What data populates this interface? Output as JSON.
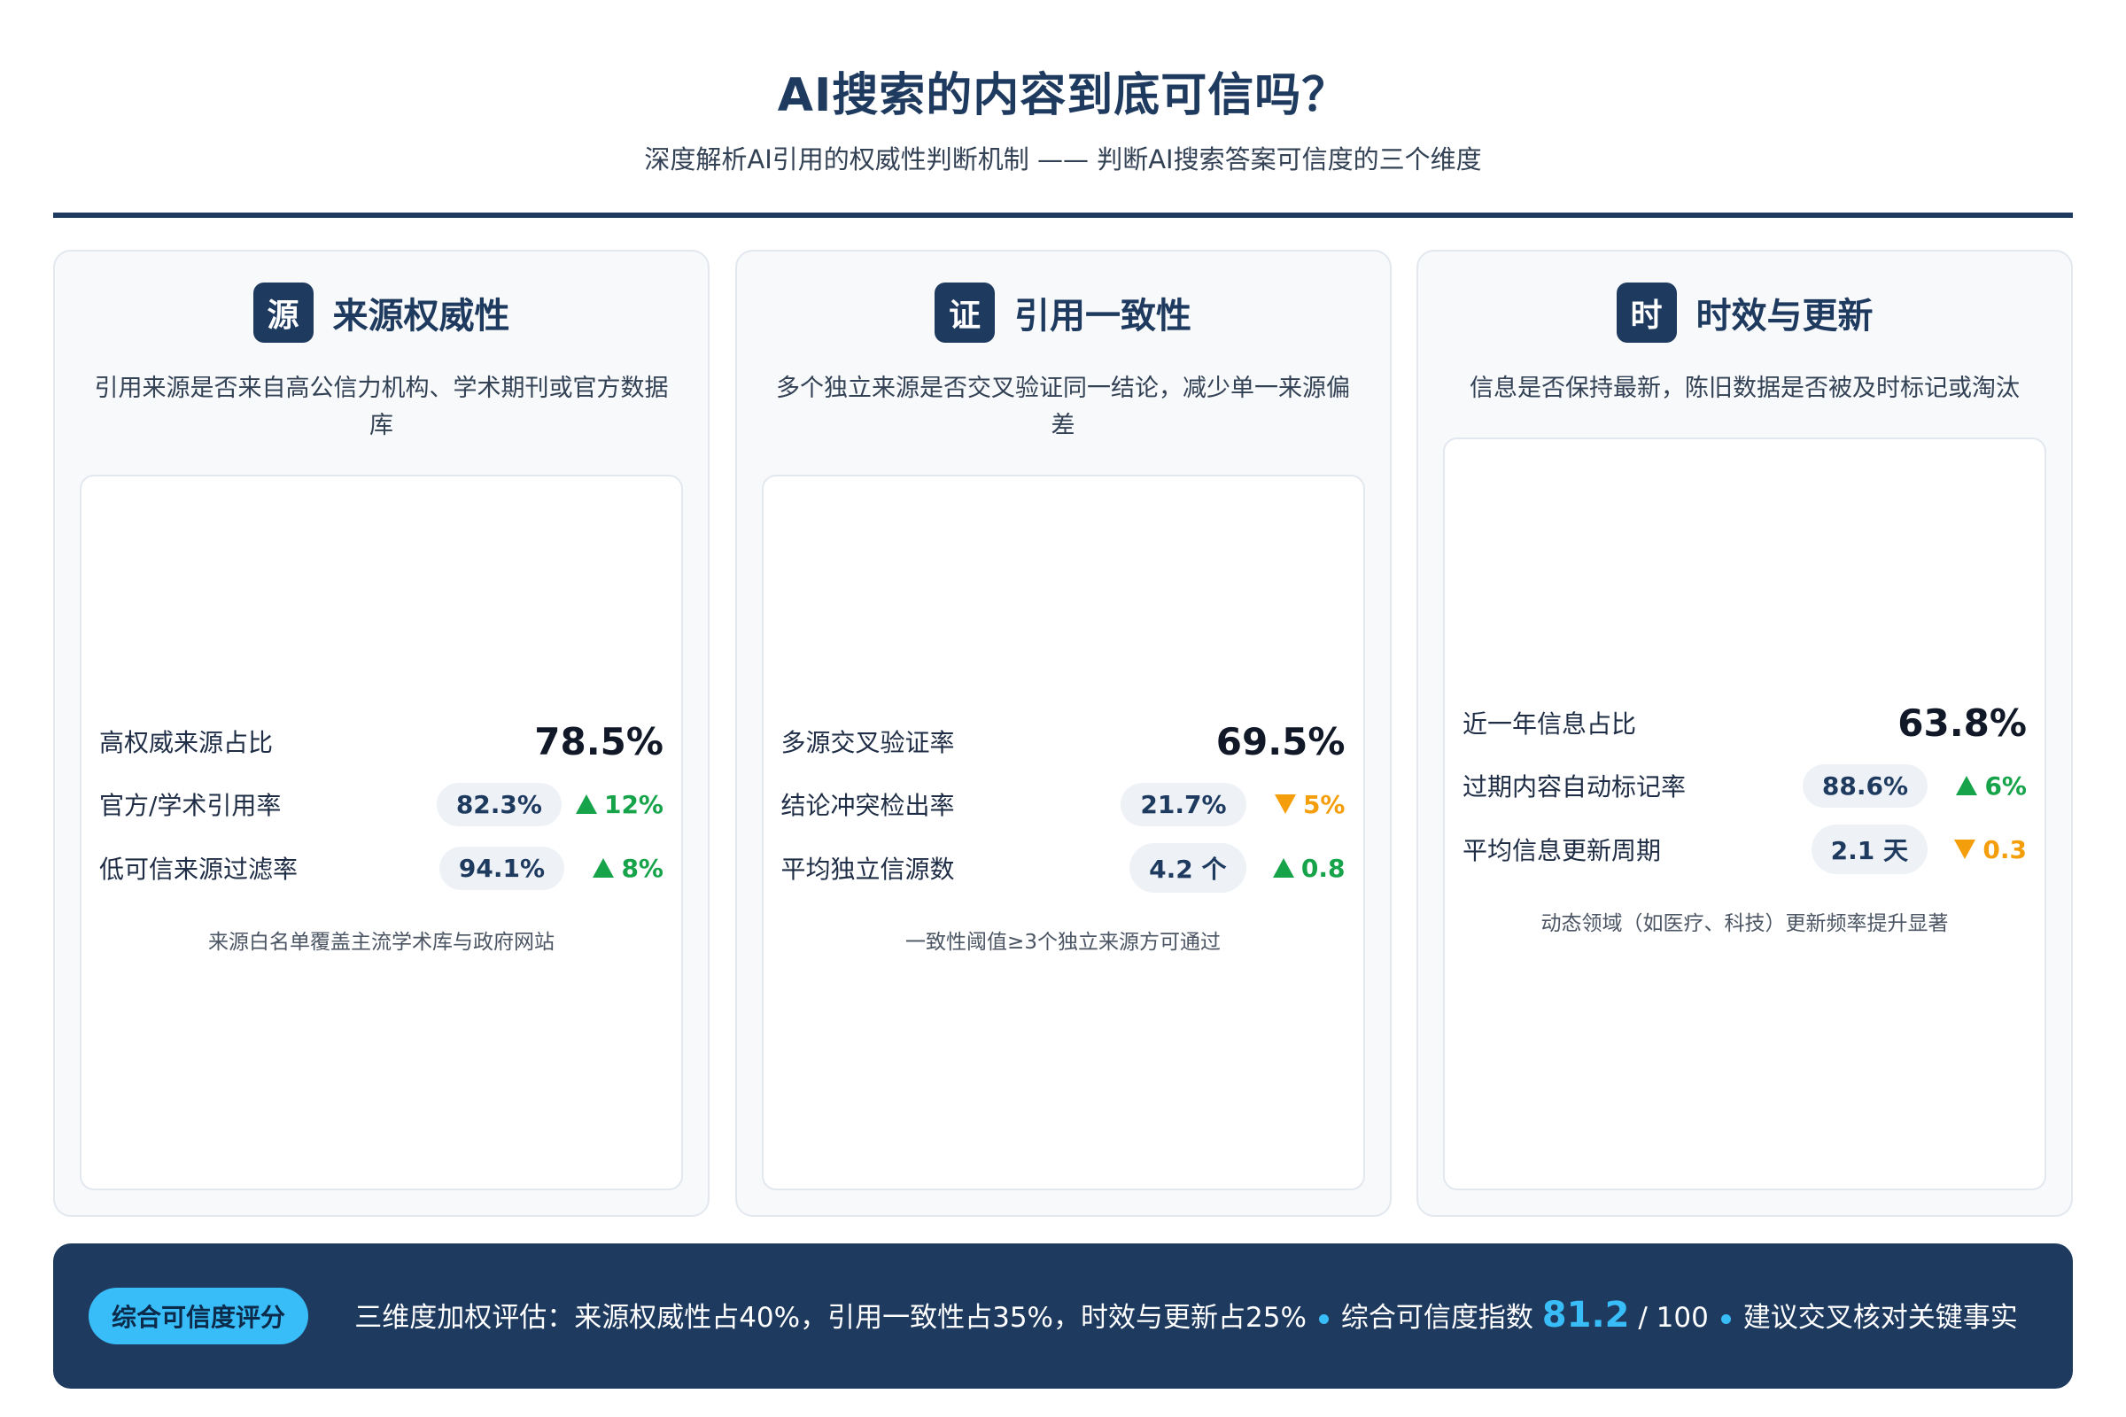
{
  "header": {
    "title": "AI搜索的内容到底可信吗？",
    "subtitle": "深度解析AI引用的权威性判断机制 —— 判断AI搜索答案可信度的三个维度"
  },
  "cards": [
    {
      "badge": "源",
      "title": "来源权威性",
      "description": "引用来源是否来自高公信力机构、学术期刊或官方数据库",
      "main": {
        "label": "高权威来源占比",
        "value": "78.5%"
      },
      "rows": [
        {
          "label": "官方/学术引用率",
          "value": "82.3%",
          "delta": "12%",
          "direction": "up"
        },
        {
          "label": "低可信来源过滤率",
          "value": "94.1%",
          "delta": "8%",
          "direction": "up"
        }
      ],
      "note": "来源白名单覆盖主流学术库与政府网站"
    },
    {
      "badge": "证",
      "title": "引用一致性",
      "description": "多个独立来源是否交叉验证同一结论，减少单一来源偏差",
      "main": {
        "label": "多源交叉验证率",
        "value": "69.5%"
      },
      "rows": [
        {
          "label": "结论冲突检出率",
          "value": "21.7%",
          "delta": "5%",
          "direction": "down"
        },
        {
          "label": "平均独立信源数",
          "value": "4.2 个",
          "delta": "0.8",
          "direction": "up"
        }
      ],
      "note": "一致性阈值≥3个独立来源方可通过"
    },
    {
      "badge": "时",
      "title": "时效与更新",
      "description": "信息是否保持最新，陈旧数据是否被及时标记或淘汰",
      "main": {
        "label": "近一年信息占比",
        "value": "63.8%"
      },
      "rows": [
        {
          "label": "过期内容自动标记率",
          "value": "88.6%",
          "delta": "6%",
          "direction": "up"
        },
        {
          "label": "平均信息更新周期",
          "value": "2.1 天",
          "delta": "0.3",
          "direction": "down"
        }
      ],
      "note": "动态领域（如医疗、科技）更新频率提升显著"
    }
  ],
  "summary": {
    "badge": "综合可信度评分",
    "weights": "三维度加权评估：来源权威性占40%，引用一致性占35%，时效与更新占25%",
    "index_label": "综合可信度指数",
    "score": "81.2",
    "score_max": "/ 100",
    "advice": "建议交叉核对关键事实"
  },
  "colors": {
    "primary": "#1e3a5f",
    "accent": "#38bdf8",
    "up": "#16a34a",
    "down": "#f59e0b"
  }
}
